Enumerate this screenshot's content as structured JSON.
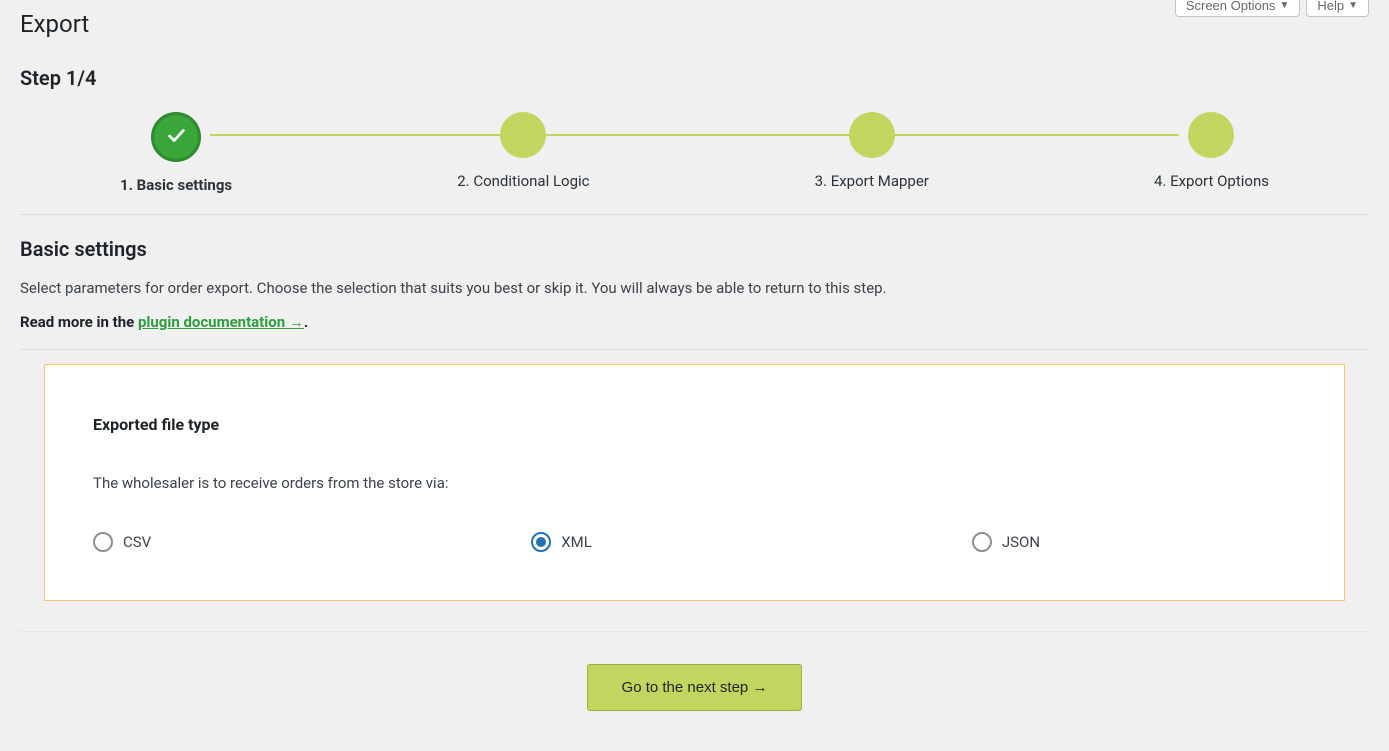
{
  "topButtons": {
    "screenOptions": "Screen Options",
    "help": "Help"
  },
  "page": {
    "title": "Export",
    "stepHeading": "Step 1/4"
  },
  "stepper": {
    "steps": [
      {
        "label": "1. Basic settings",
        "active": true
      },
      {
        "label": "2. Conditional Logic",
        "active": false
      },
      {
        "label": "3. Export Mapper",
        "active": false
      },
      {
        "label": "4. Export Options",
        "active": false
      }
    ]
  },
  "section": {
    "title": "Basic settings",
    "description": "Select parameters for order export. Choose the selection that suits you best or skip it. You will always be able to return to this step.",
    "docPrefix": "Read more in the ",
    "docLinkText": "plugin documentation →",
    "docSuffix": "."
  },
  "panel": {
    "heading": "Exported file type",
    "subtext": "The wholesaler is to receive orders from the store via:",
    "options": [
      {
        "value": "csv",
        "label": "CSV",
        "selected": false
      },
      {
        "value": "xml",
        "label": "XML",
        "selected": true
      },
      {
        "value": "json",
        "label": "JSON",
        "selected": false
      }
    ]
  },
  "actions": {
    "nextButton": "Go to the next step →"
  }
}
